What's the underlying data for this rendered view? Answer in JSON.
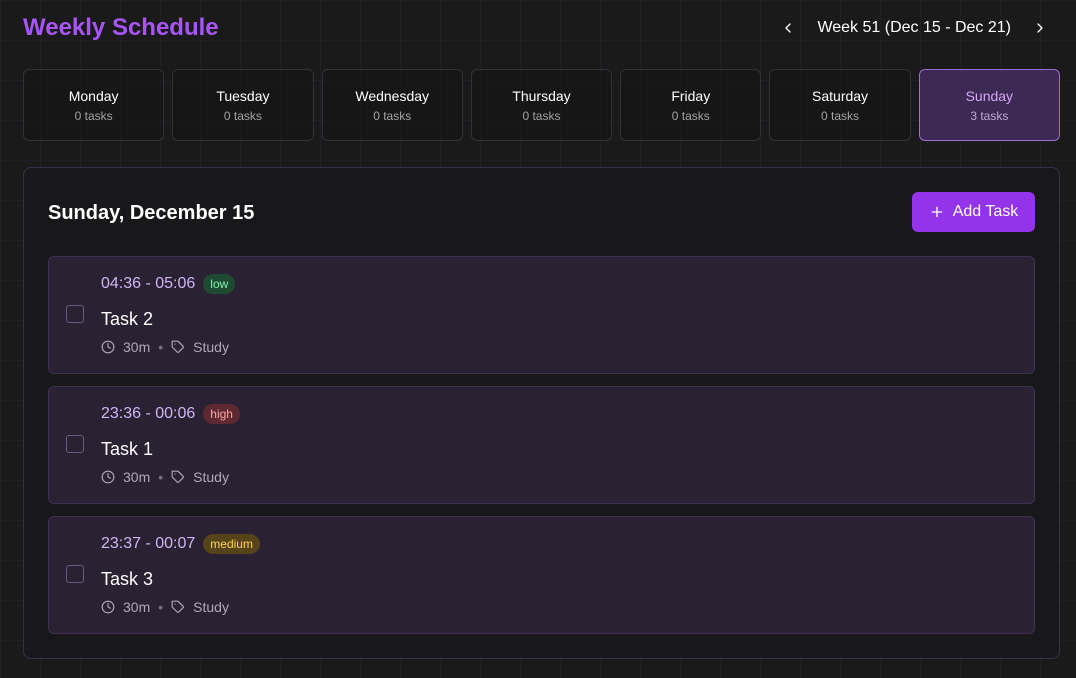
{
  "header": {
    "title": "Weekly Schedule",
    "week_label": "Week 51 (Dec 15 - Dec 21)"
  },
  "days": [
    {
      "name": "Monday",
      "count": "0 tasks"
    },
    {
      "name": "Tuesday",
      "count": "0 tasks"
    },
    {
      "name": "Wednesday",
      "count": "0 tasks"
    },
    {
      "name": "Thursday",
      "count": "0 tasks"
    },
    {
      "name": "Friday",
      "count": "0 tasks"
    },
    {
      "name": "Saturday",
      "count": "0 tasks"
    },
    {
      "name": "Sunday",
      "count": "3 tasks"
    }
  ],
  "selected_day": "Sunday",
  "main": {
    "heading": "Sunday, December 15",
    "add_label": "Add Task"
  },
  "tasks": [
    {
      "time": "04:36 - 05:06",
      "priority": "low",
      "title": "Task 2",
      "duration": "30m",
      "tag": "Study"
    },
    {
      "time": "23:36 - 00:06",
      "priority": "high",
      "title": "Task 1",
      "duration": "30m",
      "tag": "Study"
    },
    {
      "time": "23:37 - 00:07",
      "priority": "medium",
      "title": "Task 3",
      "duration": "30m",
      "tag": "Study"
    }
  ],
  "colors": {
    "accent": "#9333ea",
    "title": "#a855f7",
    "priority_low_bg": "#1f4a32",
    "priority_low_fg": "#86efac",
    "priority_high_bg": "#5c2a30",
    "priority_high_fg": "#fca5a5",
    "priority_medium_bg": "#56431a",
    "priority_medium_fg": "#fcd34d"
  },
  "icons": {
    "prev": "chevron-left-icon",
    "next": "chevron-right-icon",
    "add": "plus-icon",
    "duration": "clock-icon",
    "tag": "tag-icon"
  }
}
